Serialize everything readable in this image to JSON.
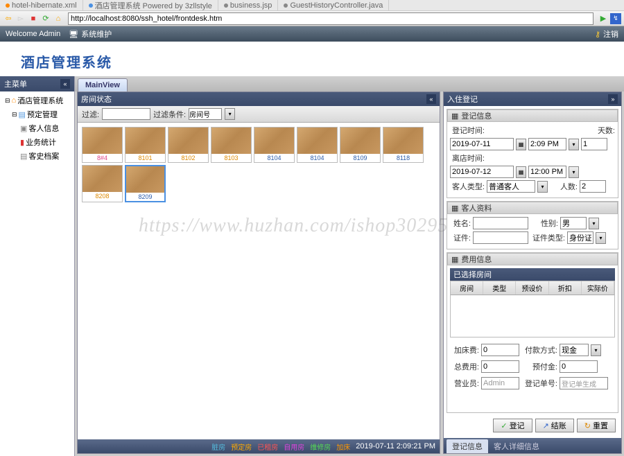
{
  "ide_tabs": [
    {
      "name": "hotel-hibernate.xml",
      "color": "#888"
    },
    {
      "name": "酒店管理系统 Powered by 3zllstyle",
      "color": "#4a90e2"
    },
    {
      "name": "business.jsp",
      "color": "#888"
    },
    {
      "name": "GuestHistoryController.java",
      "color": "#888"
    }
  ],
  "url": "http://localhost:8080/ssh_hotel/frontdesk.htm",
  "header": {
    "welcome": "Welcome Admin",
    "syslink": "系统维护",
    "logout": "注销"
  },
  "logo": "酒店管理系统",
  "sidebar": {
    "title": "主菜单",
    "nodes": [
      {
        "label": "酒店管理系统",
        "icon": "home-icon",
        "level": 0
      },
      {
        "label": "预定管理",
        "icon": "booking-icon",
        "level": 1
      },
      {
        "label": "客人信息",
        "icon": "guest-icon",
        "level": 2
      },
      {
        "label": "业务统计",
        "icon": "stats-icon",
        "level": 2
      },
      {
        "label": "客史档案",
        "icon": "history-icon",
        "level": 2
      }
    ]
  },
  "mainview_tab": "MainView",
  "rooms_panel": {
    "title": "房间状态",
    "filter_lbl": "过滤:",
    "filter_cond": "过滤条件:",
    "cond_value": "房间号"
  },
  "rooms": [
    {
      "num": "8#4",
      "color": "#d48"
    },
    {
      "num": "8101",
      "color": "#d80"
    },
    {
      "num": "8102",
      "color": "#d80"
    },
    {
      "num": "8103",
      "color": "#d80"
    },
    {
      "num": "8104",
      "color": "#2a5aa8"
    },
    {
      "num": "8104",
      "color": "#2a5aa8"
    },
    {
      "num": "8109",
      "color": "#2a5aa8"
    },
    {
      "num": "8118",
      "color": "#2a5aa8"
    },
    {
      "num": "8208",
      "color": "#d80"
    },
    {
      "num": "8209",
      "color": "#2a5aa8",
      "sel": true
    }
  ],
  "status_legend": [
    {
      "label": "脏房",
      "color": "#5bd"
    },
    {
      "label": "预定房",
      "color": "#fa0"
    },
    {
      "label": "已租房",
      "color": "#f55"
    },
    {
      "label": "自用房",
      "color": "#d4d"
    },
    {
      "label": "维修房",
      "color": "#5d5"
    },
    {
      "label": "加床",
      "color": "#f90"
    }
  ],
  "status_date": "2019-07-11",
  "status_time": "2:09:21 PM",
  "checkin": {
    "title": "入住登记",
    "reg_info": {
      "title": "登记信息",
      "checkin_lbl": "登记时间:",
      "checkin_date": "2019-07-11",
      "checkin_time": "2:09 PM",
      "days_lbl": "天数:",
      "days": "1",
      "checkout_lbl": "离店时间:",
      "checkout_date": "2019-07-12",
      "checkout_time": "12:00 PM",
      "guest_type_lbl": "客人类型:",
      "guest_type": "普通客人",
      "count_lbl": "人数:",
      "count": "2"
    },
    "guest_info": {
      "title": "客人资料",
      "name_lbl": "姓名:",
      "gender_lbl": "性别:",
      "gender": "男",
      "id_lbl": "证件:",
      "id_type_lbl": "证件类型:",
      "id_type": "身份证"
    },
    "fee_info": {
      "title": "费用信息",
      "selected_rooms": "已选择房间",
      "cols": [
        "房间",
        "类型",
        "预设价",
        "折扣",
        "实际价"
      ],
      "extra_bed_lbl": "加床费:",
      "extra_bed": "0",
      "pay_method_lbl": "付款方式:",
      "pay_method": "现金",
      "total_lbl": "总费用:",
      "total": "0",
      "prepay_lbl": "预付金:",
      "prepay": "0",
      "staff_lbl": "营业员:",
      "staff": "Admin",
      "order_lbl": "登记单号:",
      "order": "登记单生成"
    },
    "buttons": {
      "reg": "登记",
      "checkout": "结账",
      "reset": "重置"
    }
  },
  "bottom_tabs": [
    {
      "label": "登记信息",
      "active": true
    },
    {
      "label": "客人详细信息",
      "active": false
    }
  ],
  "watermark": "https://www.huzhan.com/ishop30295"
}
